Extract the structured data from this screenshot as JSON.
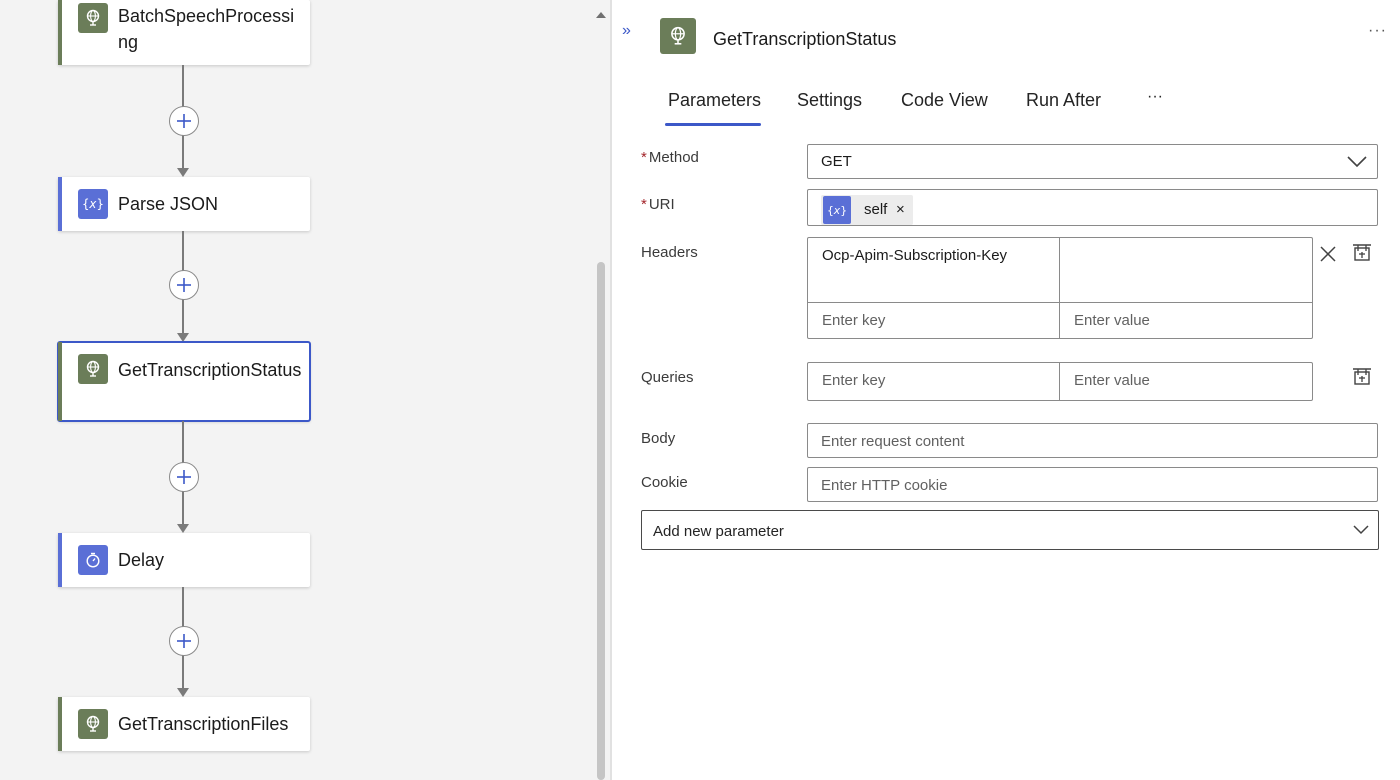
{
  "canvas": {
    "nodes": [
      {
        "title": "BatchSpeechProcessing",
        "icon": "globe-icon"
      },
      {
        "title": "Parse JSON",
        "icon": "braces-icon"
      },
      {
        "title": "GetTranscriptionStatus",
        "icon": "globe-icon"
      },
      {
        "title": "Delay",
        "icon": "timer-icon"
      },
      {
        "title": "GetTranscriptionFiles",
        "icon": "globe-icon"
      }
    ]
  },
  "panel": {
    "title": "GetTranscriptionStatus",
    "collapse_label": "»",
    "more_label": "···",
    "tabs": [
      {
        "label": "Parameters",
        "active": true
      },
      {
        "label": "Settings"
      },
      {
        "label": "Code View"
      },
      {
        "label": "Run After"
      },
      {
        "label": "···"
      }
    ],
    "fields": {
      "method": {
        "required": "*",
        "label": "Method",
        "value": "GET"
      },
      "uri": {
        "required": "*",
        "label": "URI",
        "token": "self",
        "token_remove": "×"
      },
      "headers": {
        "label": "Headers",
        "rows": [
          {
            "key": "Ocp-Apim-Subscription-Key",
            "value": ""
          }
        ],
        "key_placeholder": "Enter key",
        "value_placeholder": "Enter value",
        "remove_label": "×"
      },
      "queries": {
        "label": "Queries",
        "key_placeholder": "Enter key",
        "value_placeholder": "Enter value"
      },
      "body": {
        "label": "Body",
        "placeholder": "Enter request content"
      },
      "cookie": {
        "label": "Cookie",
        "placeholder": "Enter HTTP cookie"
      },
      "add_param": {
        "label": "Add new parameter"
      }
    }
  },
  "colors": {
    "accent": "#3c58c8",
    "http_green": "#6b7d59",
    "builtin_blue": "#5a6fd6"
  }
}
